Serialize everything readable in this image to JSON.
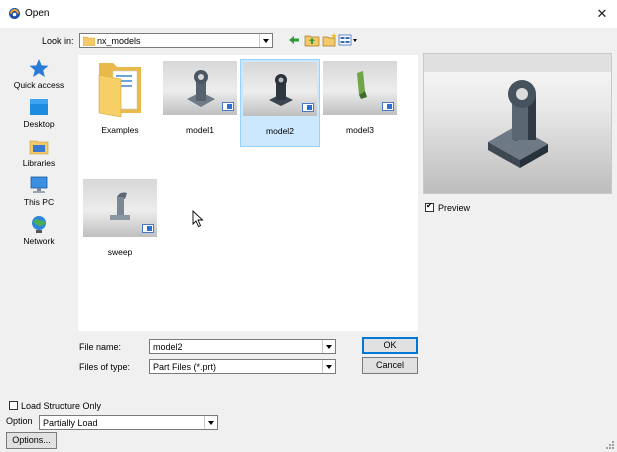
{
  "window": {
    "title": "Open",
    "close_glyph": "✕"
  },
  "toolbar": {
    "look_in_label": "Look in:",
    "look_in_value": "nx_models",
    "icons": [
      "back-arrow-icon",
      "up-folder-icon",
      "new-folder-icon",
      "view-menu-icon"
    ]
  },
  "places": [
    {
      "label": "Quick access",
      "icon": "star-icon"
    },
    {
      "label": "Desktop",
      "icon": "desktop-icon"
    },
    {
      "label": "Libraries",
      "icon": "libraries-icon"
    },
    {
      "label": "This PC",
      "icon": "computer-icon"
    },
    {
      "label": "Network",
      "icon": "network-icon"
    }
  ],
  "files": [
    {
      "name": "Examples",
      "kind": "folder",
      "selected": false
    },
    {
      "name": "model1",
      "kind": "part",
      "selected": false
    },
    {
      "name": "model2",
      "kind": "part",
      "selected": true
    },
    {
      "name": "model3",
      "kind": "part",
      "selected": false
    },
    {
      "name": "sweep",
      "kind": "part",
      "selected": false
    }
  ],
  "form": {
    "file_name_label": "File name:",
    "file_name_value": "model2",
    "files_of_type_label": "Files of type:",
    "files_of_type_value": "Part Files (*.prt)",
    "ok_label": "OK",
    "cancel_label": "Cancel"
  },
  "preview": {
    "checkbox_label": "Preview",
    "checked": true
  },
  "options": {
    "load_structure_label": "Load Structure Only",
    "load_structure_checked": false,
    "option_label": "Option",
    "option_value": "Partially Load",
    "options_button_label": "Options..."
  },
  "colors": {
    "selection": "#cce8ff",
    "selection_border": "#99d1ff",
    "accent": "#0078d7"
  }
}
